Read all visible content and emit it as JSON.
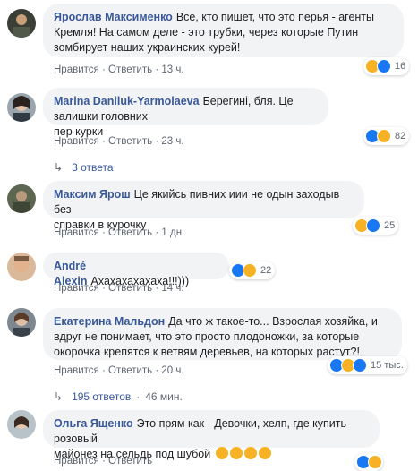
{
  "comments": [
    {
      "author": "Ярослав Максименко",
      "text_line1": "Все, кто пишет, что это перья - агенты",
      "text_line2": "Кремля! На самом деле - это трубки, через которые Путин",
      "text_line3": "зомбирует наших украинских курей!",
      "like_label": "Нравится",
      "reply_label": "Ответить",
      "time": "13 ч.",
      "reaction_count": "16",
      "reactions": [
        "haha-icon",
        "like-icon"
      ]
    },
    {
      "author": "Marina Daniluk-Yarmolaeva",
      "text_line1": "Берегині, бля. Це залишки головних",
      "text_line2": "пер курки",
      "like_label": "Нравится",
      "reply_label": "Ответить",
      "time": "23 ч.",
      "reaction_count": "82",
      "reactions": [
        "like-icon",
        "haha-icon"
      ],
      "replies_label": "3 ответа"
    },
    {
      "author": "Максим Ярош",
      "text_line1": "Це якийсь пивних иии не одын заходыв без",
      "text_line2": "справки в курочку",
      "like_label": "Нравится",
      "reply_label": "Ответить",
      "time": "1 дн.",
      "reaction_count": "25",
      "reactions": [
        "haha-icon",
        "like-icon"
      ]
    },
    {
      "author": "André Alexin",
      "text_line1": "Ахахахахахаха!!!)))",
      "like_label": "Нравится",
      "reply_label": "Ответить",
      "time": "14 ч.",
      "reaction_count": "22",
      "reactions": [
        "like-icon",
        "haha-icon"
      ]
    },
    {
      "author": "Екатерина Мальдон",
      "text_line1": "Да что ж такое-то... Взрослая хозяйка, и",
      "text_line2": "вдруг не понимает, что это просто плодоножки, за которые",
      "text_line3": "окорочка крепятся к ветвям деревьев, на которых растут?!",
      "like_label": "Нравится",
      "reply_label": "Ответить",
      "time": "20 ч.",
      "reaction_count": "15 тыс.",
      "reactions": [
        "like-icon",
        "haha-icon",
        "like-icon"
      ],
      "replies_label": "195 ответов",
      "replies_time": "46 мин."
    },
    {
      "author": "Ольга Ященко",
      "text_line1": "Это прям как - Девочки, хелп, где купить розовый",
      "text_line2": "майонез на сельдь под шубой",
      "like_label": "Нравится",
      "reply_label": "Ответить",
      "time": "",
      "reaction_count": "",
      "reactions": [
        "like-icon",
        "haha-icon"
      ]
    }
  ],
  "separator": "·",
  "colors": {
    "author": "#385898",
    "bubble": "#f2f3f5",
    "like": "#1877f2",
    "haha": "#f7b125"
  }
}
